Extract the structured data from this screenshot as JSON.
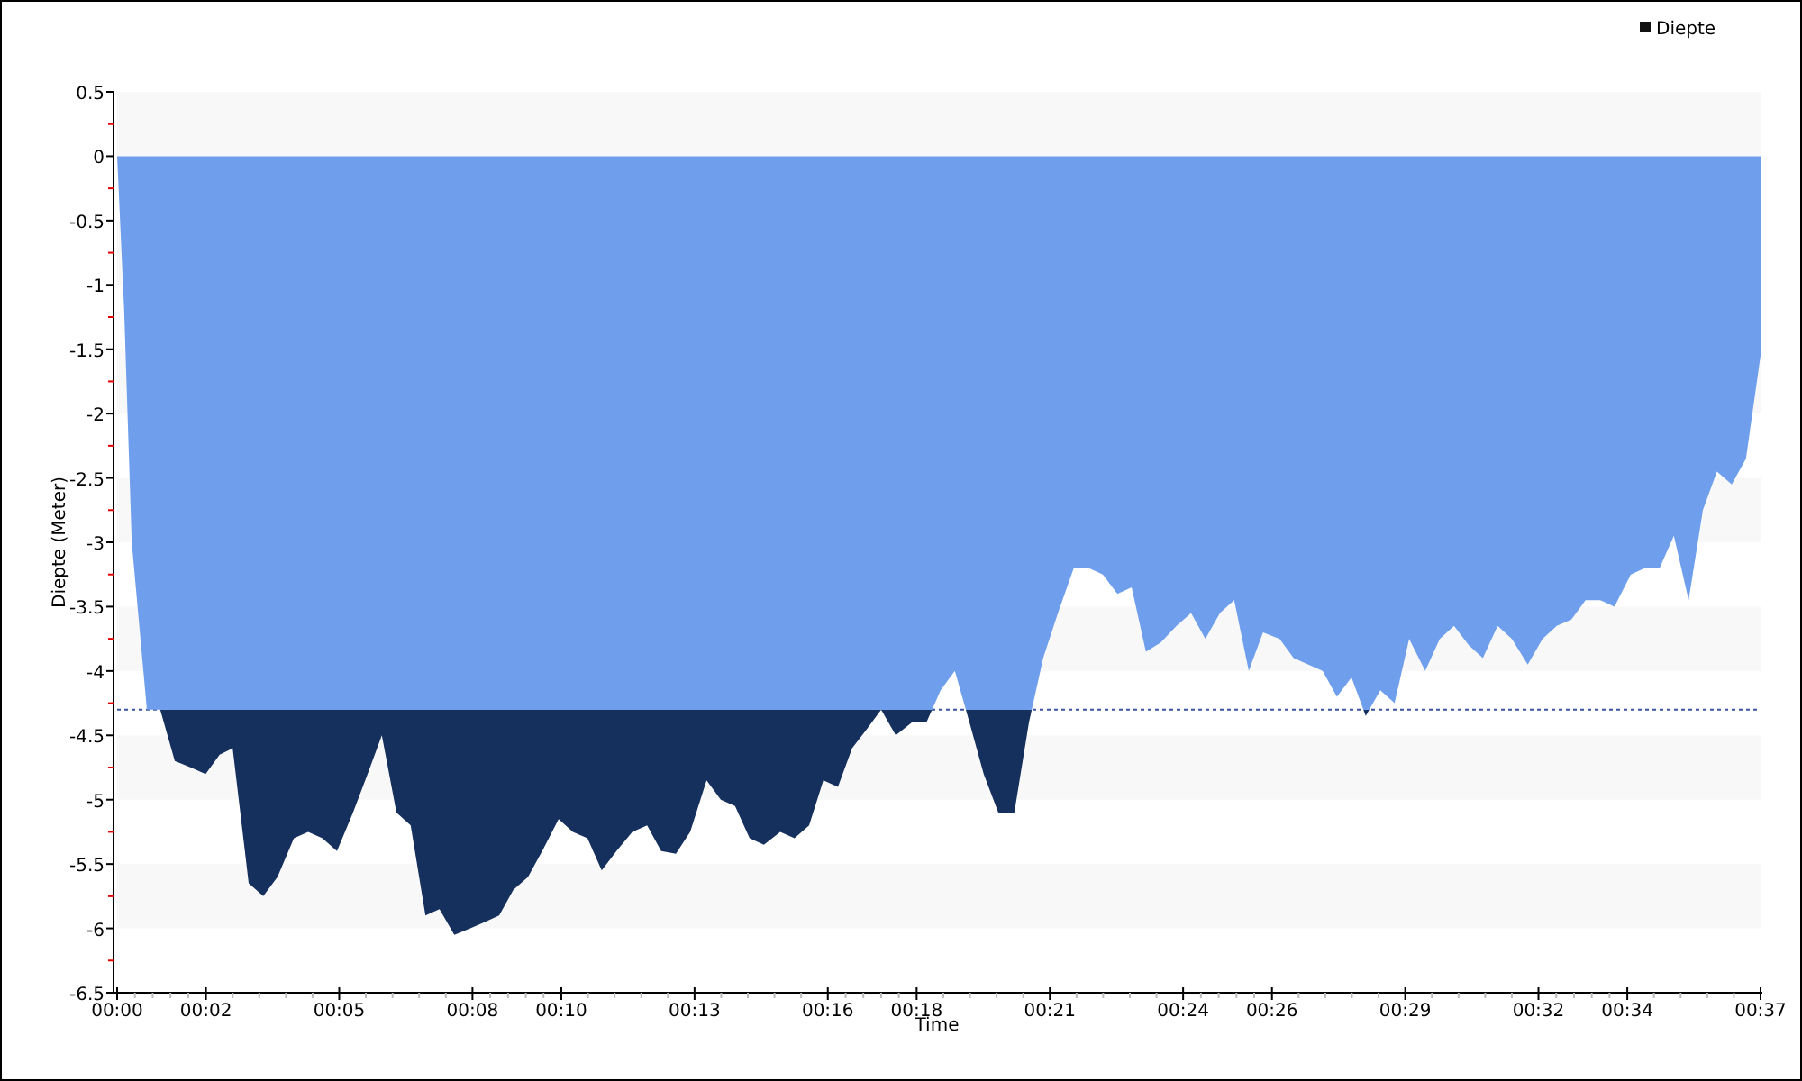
{
  "chart_data": {
    "type": "area",
    "xlabel": "Time",
    "ylabel": "Diepte (Meter)",
    "xlim": [
      0,
      37
    ],
    "ylim": [
      -6.5,
      0.5
    ],
    "xticks": [
      {
        "value": 0,
        "label": "00:00"
      },
      {
        "value": 2,
        "label": "00:02"
      },
      {
        "value": 5,
        "label": "00:05"
      },
      {
        "value": 8,
        "label": "00:08"
      },
      {
        "value": 10,
        "label": "00:10"
      },
      {
        "value": 13,
        "label": "00:13"
      },
      {
        "value": 16,
        "label": "00:16"
      },
      {
        "value": 18,
        "label": "00:18"
      },
      {
        "value": 21,
        "label": "00:21"
      },
      {
        "value": 24,
        "label": "00:24"
      },
      {
        "value": 26,
        "label": "00:26"
      },
      {
        "value": 29,
        "label": "00:29"
      },
      {
        "value": 32,
        "label": "00:32"
      },
      {
        "value": 34,
        "label": "00:34"
      },
      {
        "value": 37,
        "label": "00:37"
      }
    ],
    "yticks": [
      0.5,
      0,
      -0.5,
      -1,
      -1.5,
      -2,
      -2.5,
      -3,
      -3.5,
      -4,
      -4.5,
      -5,
      -5.5,
      -6,
      -6.5
    ],
    "x": [
      0,
      0.16,
      0.33,
      0.67,
      0.97,
      1.3,
      1.66,
      1.99,
      2.31,
      2.6,
      2.96,
      3.29,
      3.61,
      3.98,
      4.3,
      4.62,
      4.95,
      5.31,
      5.64,
      5.96,
      6.29,
      6.61,
      6.94,
      7.26,
      7.59,
      7.95,
      8.28,
      8.6,
      8.92,
      9.25,
      9.57,
      9.94,
      10.26,
      10.59,
      10.91,
      11.24,
      11.6,
      11.93,
      12.25,
      12.58,
      12.9,
      13.27,
      13.59,
      13.91,
      14.24,
      14.56,
      14.93,
      15.25,
      15.58,
      15.9,
      16.23,
      16.55,
      16.88,
      17.2,
      17.53,
      17.89,
      18.22,
      18.54,
      18.86,
      19.19,
      19.51,
      19.84,
      20.2,
      20.53,
      20.85,
      21.18,
      21.54,
      21.87,
      22.19,
      22.52,
      22.84,
      23.16,
      23.49,
      23.85,
      24.18,
      24.5,
      24.83,
      25.15,
      25.48,
      25.8,
      26.17,
      26.49,
      26.82,
      27.14,
      27.46,
      27.79,
      28.11,
      28.44,
      28.76,
      29.09,
      29.45,
      29.78,
      30.1,
      30.43,
      30.75,
      31.08,
      31.4,
      31.76,
      32.09,
      32.41,
      32.74,
      33.06,
      33.39,
      33.71,
      34.08,
      34.4,
      34.73,
      35.05,
      35.38,
      35.7,
      36.02,
      36.35,
      36.67,
      37.0
    ],
    "series": [
      {
        "name": "Diepte",
        "color": "#6f9fec",
        "values": [
          0,
          -1.2,
          -3,
          -4.3,
          -4.3,
          -4.7,
          -4.75,
          -4.8,
          -4.65,
          -4.6,
          -5.65,
          -5.75,
          -5.6,
          -5.3,
          -5.25,
          -5.3,
          -5.4,
          -5.1,
          -4.8,
          -4.5,
          -5.1,
          -5.2,
          -5.9,
          -5.85,
          -6.05,
          -6.0,
          -5.95,
          -5.9,
          -5.7,
          -5.6,
          -5.4,
          -5.15,
          -5.25,
          -5.3,
          -5.55,
          -5.4,
          -5.25,
          -5.2,
          -5.4,
          -5.42,
          -5.25,
          -4.85,
          -5.0,
          -5.05,
          -5.3,
          -5.35,
          -5.25,
          -5.3,
          -5.2,
          -4.85,
          -4.9,
          -4.6,
          -4.45,
          -4.3,
          -4.5,
          -4.4,
          -4.4,
          -4.15,
          -4.0,
          -4.4,
          -4.8,
          -5.1,
          -5.1,
          -4.4,
          -3.9,
          -3.55,
          -3.2,
          -3.2,
          -3.25,
          -3.4,
          -3.35,
          -3.85,
          -3.78,
          -3.65,
          -3.55,
          -3.75,
          -3.55,
          -3.45,
          -4.0,
          -3.7,
          -3.75,
          -3.9,
          -3.95,
          -4.0,
          -4.2,
          -4.05,
          -4.35,
          -4.15,
          -4.25,
          -3.75,
          -4.0,
          -3.75,
          -3.65,
          -3.8,
          -3.9,
          -3.65,
          -3.75,
          -3.95,
          -3.75,
          -3.65,
          -3.6,
          -3.45,
          -3.45,
          -3.5,
          -3.25,
          -3.2,
          -3.2,
          -2.95,
          -3.45,
          -2.75,
          -2.45,
          -2.55,
          -2.35,
          -1.55
        ]
      }
    ],
    "ref_lines": [
      {
        "axis": "y",
        "value": -4.3,
        "color": "#3a55a0"
      }
    ]
  }
}
